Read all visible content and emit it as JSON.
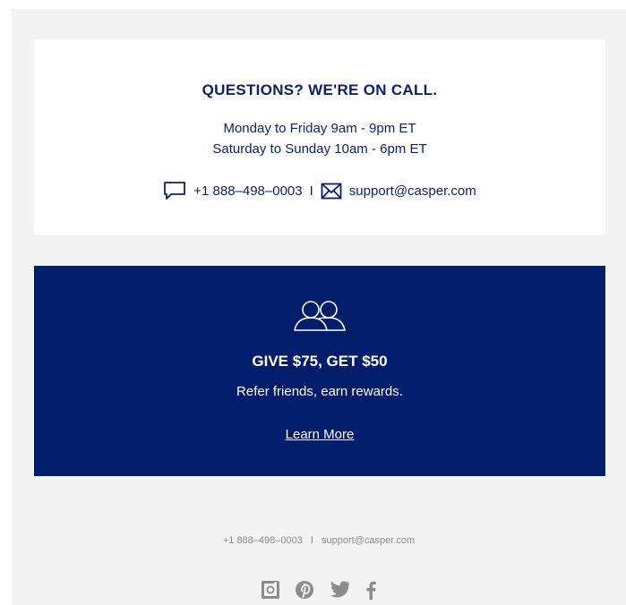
{
  "contact": {
    "title": "QUESTIONS? WE'RE ON CALL.",
    "hours_weekday": "Monday to Friday 9am - 9pm ET",
    "hours_weekend": "Saturday to Sunday 10am - 6pm ET",
    "phone": "+1 888–498–0003",
    "separator": "I",
    "email": "support@casper.com",
    "icons": [
      "chat-icon",
      "mail-icon"
    ]
  },
  "referral": {
    "icon": "people-icon",
    "heading": "GIVE $75, GET $50",
    "subtext": "Refer friends, earn rewards.",
    "link_label": "Learn More"
  },
  "footer": {
    "phone": "+1 888–498–0003",
    "separator": "I",
    "email": "support@casper.com",
    "social_icons": [
      "instagram-icon",
      "pinterest-icon",
      "twitter-icon",
      "facebook-icon"
    ]
  },
  "colors": {
    "navy": "#021d6b",
    "text_navy": "#0b1f6e",
    "background": "#f3f3f3",
    "footer_gray": "#8c8c8c"
  }
}
